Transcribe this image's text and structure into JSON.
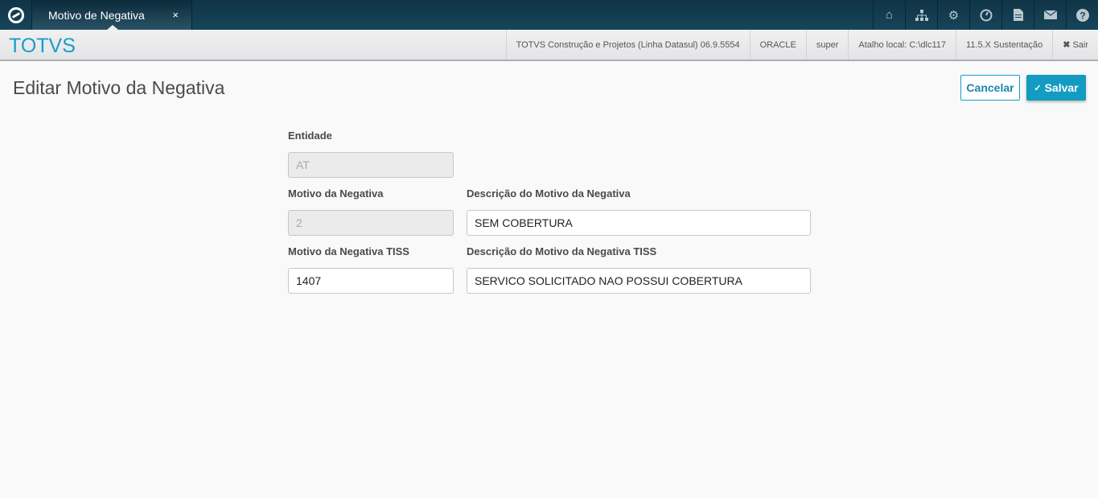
{
  "topbar": {
    "tab_label": "Motivo de Negativa",
    "tab_close": "×",
    "icons": [
      "home-icon",
      "sitemap-icon",
      "gear-icon",
      "clock-icon",
      "document-icon",
      "mail-icon",
      "help-icon"
    ]
  },
  "header": {
    "brand": "TOTVS",
    "product": "TOTVS Construção e Projetos (Linha Datasul) 06.9.5554",
    "database": "ORACLE",
    "user": "super",
    "shortcut": "Atalho local: C:\\dlc117",
    "version": "11.5.X Sustentação",
    "logout": "Sair"
  },
  "page": {
    "title": "Editar Motivo da Negativa",
    "cancel": "Cancelar",
    "save": "Salvar"
  },
  "form": {
    "entidade": {
      "label": "Entidade",
      "value": "AT"
    },
    "motivo": {
      "label": "Motivo da Negativa",
      "value": "2"
    },
    "descricao": {
      "label": "Descrição do Motivo da Negativa",
      "value": "SEM COBERTURA"
    },
    "motivo_tiss": {
      "label": "Motivo da Negativa TISS",
      "value": "1407"
    },
    "descricao_tiss": {
      "label": "Descrição do Motivo da Negativa TISS",
      "value": "SERVICO SOLICITADO NAO POSSUI COBERTURA"
    }
  }
}
